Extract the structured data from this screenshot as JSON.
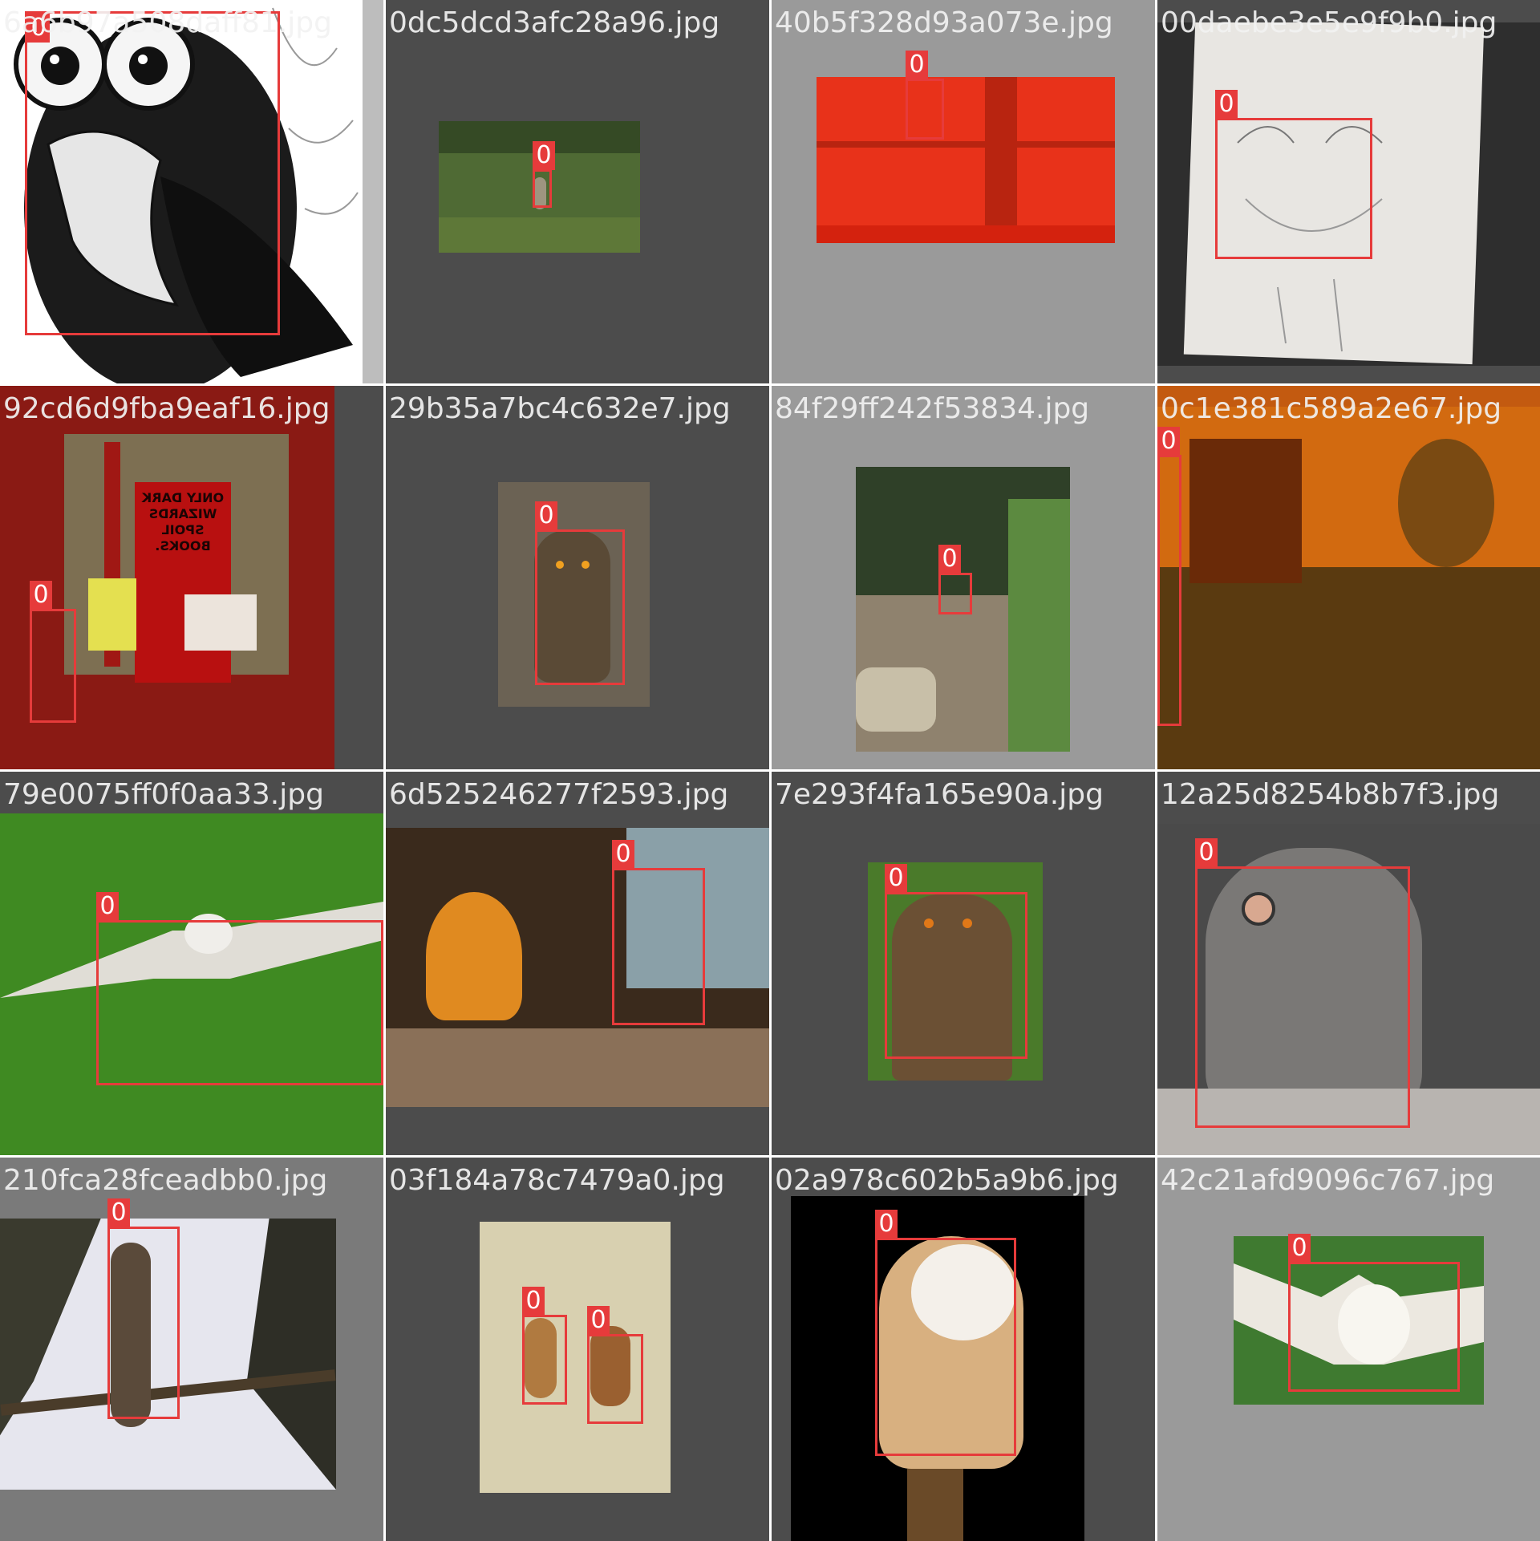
{
  "grid": {
    "tiles": [
      {
        "filename": "6a6b97a508daff81.jpg",
        "labels": [
          "0"
        ]
      },
      {
        "filename": "0dc5dcd3afc28a96.jpg",
        "labels": [
          "0"
        ]
      },
      {
        "filename": "40b5f328d93a073e.jpg",
        "labels": [
          "0"
        ]
      },
      {
        "filename": "00daebe3e5e9f9b0.jpg",
        "labels": [
          "0"
        ]
      },
      {
        "filename": "92cd6d9fba9eaf16.jpg",
        "labels": [
          "0"
        ]
      },
      {
        "filename": "29b35a7bc4c632e7.jpg",
        "labels": [
          "0"
        ]
      },
      {
        "filename": "84f29ff242f53834.jpg",
        "labels": [
          "0"
        ]
      },
      {
        "filename": "0c1e381c589a2e67.jpg",
        "labels": [
          "0"
        ]
      },
      {
        "filename": "79e0075ff0f0aa33.jpg",
        "labels": [
          "0"
        ]
      },
      {
        "filename": "6d525246277f2593.jpg",
        "labels": [
          "0"
        ]
      },
      {
        "filename": "7e293f4fa165e90a.jpg",
        "labels": [
          "0"
        ]
      },
      {
        "filename": "12a25d8254b8b7f3.jpg",
        "labels": [
          "0"
        ]
      },
      {
        "filename": "210fca28fceadbb0.jpg",
        "labels": [
          "0"
        ]
      },
      {
        "filename": "03f184a78c7479a0.jpg",
        "labels": [
          "0",
          "0"
        ]
      },
      {
        "filename": "02a978c602b5a9b6.jpg",
        "labels": [
          "0"
        ]
      },
      {
        "filename": "42c21afd9096c767.jpg",
        "labels": [
          "0"
        ]
      }
    ]
  },
  "sign_text": "ONLY DARK WIZARDS SPOIL BOOKS."
}
